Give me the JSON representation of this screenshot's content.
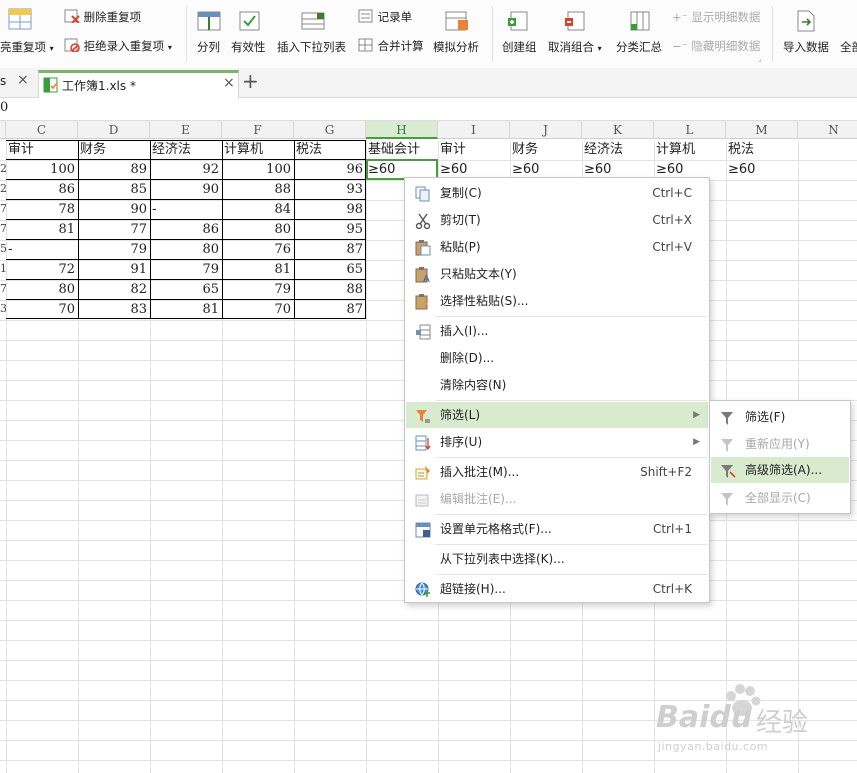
{
  "ribbon": {
    "remove_duplicates": "删除重复项",
    "highlight_duplicates": "亮重复项",
    "reject_duplicates": "拒绝录入重复项",
    "split": "分列",
    "validity": "有效性",
    "insert_dropdown": "插入下拉列表",
    "record_form": "记录单",
    "consolidate": "合并计算",
    "what_if": "模拟分析",
    "group": "创建组",
    "ungroup": "取消组合",
    "subtotal": "分类汇总",
    "show_detail": "显示明细数据",
    "hide_detail": "隐藏明细数据",
    "import_data": "导入数据",
    "all": "全部"
  },
  "tabs": {
    "prev_fragment": "s",
    "active_label": "工作簿1.xls *",
    "close": "×",
    "add": "+"
  },
  "formula_bar": {
    "value": "0"
  },
  "columns": [
    "C",
    "D",
    "E",
    "F",
    "G",
    "H",
    "I",
    "J",
    "K",
    "L",
    "M",
    "N"
  ],
  "row_fragments": [
    "2",
    "2",
    "7",
    "7",
    "5",
    "1",
    "7",
    "3"
  ],
  "headers": [
    "审计",
    "财务",
    "经济法",
    "计算机",
    "税法",
    "基础会计",
    "审计",
    "财务",
    "经济法",
    "计算机",
    "税法"
  ],
  "criteria": [
    "≥60",
    "≥60",
    "≥60",
    "≥60",
    "≥60",
    "≥60"
  ],
  "rows": [
    [
      "100",
      "89",
      "92",
      "100",
      "96"
    ],
    [
      "86",
      "85",
      "90",
      "88",
      "93"
    ],
    [
      "78",
      "90",
      "-",
      "84",
      "98"
    ],
    [
      "81",
      "77",
      "86",
      "80",
      "95"
    ],
    [
      "-",
      "79",
      "80",
      "76",
      "87"
    ],
    [
      "72",
      "91",
      "79",
      "81",
      "65"
    ],
    [
      "80",
      "82",
      "65",
      "79",
      "88"
    ],
    [
      "70",
      "83",
      "81",
      "70",
      "87"
    ]
  ],
  "context_menu": {
    "copy": "复制(C)",
    "copy_key": "Ctrl+C",
    "cut": "剪切(T)",
    "cut_key": "Ctrl+X",
    "paste": "粘贴(P)",
    "paste_key": "Ctrl+V",
    "paste_text": "只粘贴文本(Y)",
    "paste_special": "选择性粘贴(S)...",
    "insert": "插入(I)...",
    "delete": "删除(D)...",
    "clear": "清除内容(N)",
    "filter": "筛选(L)",
    "sort": "排序(U)",
    "insert_comment": "插入批注(M)...",
    "insert_comment_key": "Shift+F2",
    "edit_comment": "编辑批注(E)...",
    "format_cells": "设置单元格格式(F)...",
    "format_cells_key": "Ctrl+1",
    "pick_from_list": "从下拉列表中选择(K)...",
    "hyperlink": "超链接(H)...",
    "hyperlink_key": "Ctrl+K"
  },
  "filter_submenu": {
    "filter": "筛选(F)",
    "reapply": "重新应用(Y)",
    "advanced": "高级筛选(A)...",
    "show_all": "全部显示(C)"
  },
  "watermark": {
    "brand": "Baidu",
    "brand_cn": "经验",
    "url": "jingyan.baidu.com"
  },
  "colors": {
    "accent_green": "#4a9d3c",
    "highlight": "#d8ebcf",
    "filter_orange": "#e8833a"
  }
}
